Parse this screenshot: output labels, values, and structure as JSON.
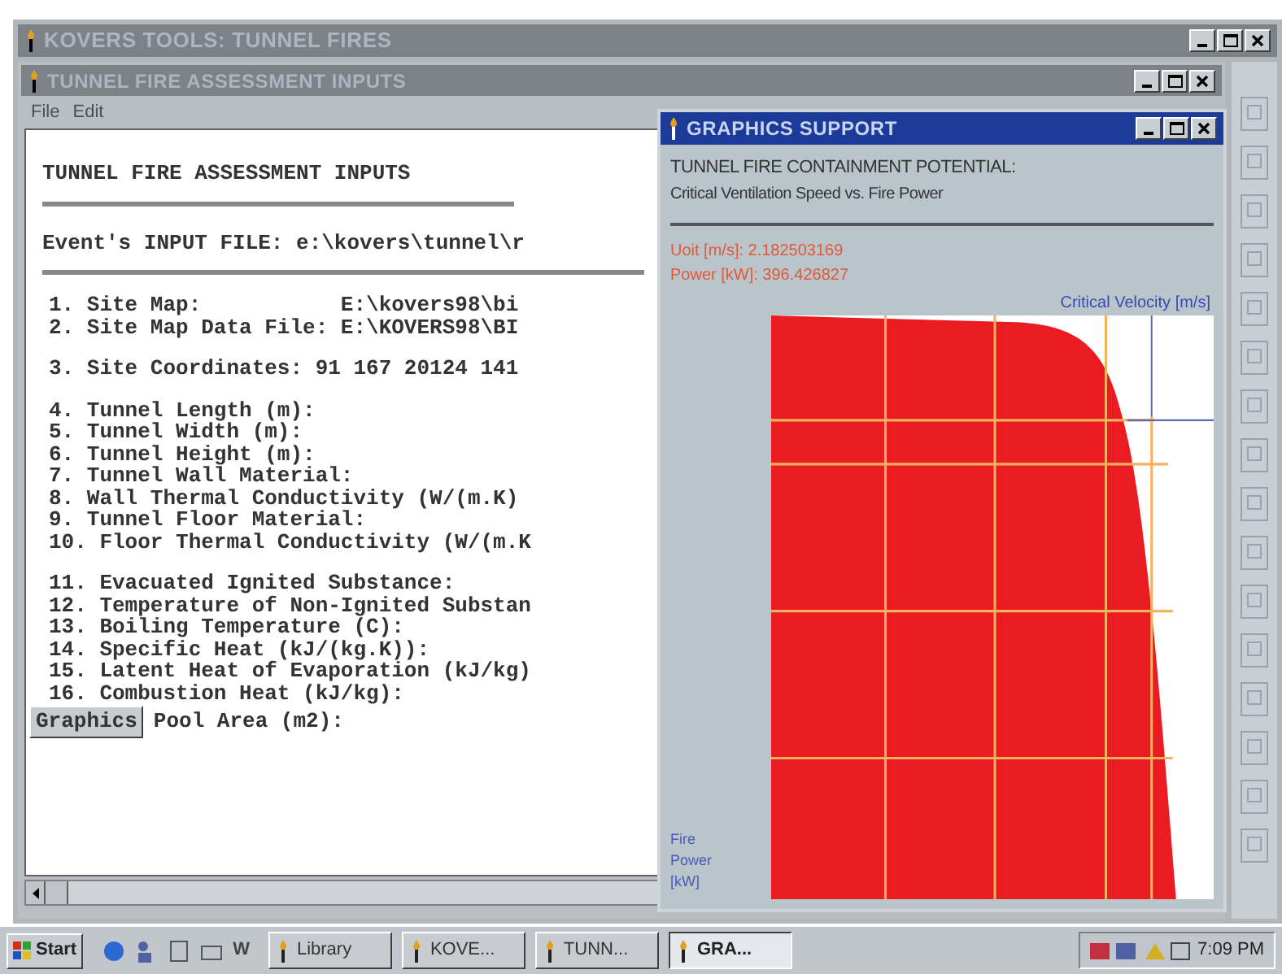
{
  "main_window": {
    "title": "KOVERS TOOLS: TUNNEL FIRES"
  },
  "inputs_window": {
    "title": "TUNNEL FIRE ASSESSMENT INPUTS",
    "menu": [
      "File",
      "Edit"
    ],
    "heading": "TUNNEL FIRE ASSESSMENT INPUTS",
    "input_file": "Event's INPUT FILE: e:\\kovers\\tunnel\\r",
    "groups": [
      [
        "1. Site Map:           E:\\kovers98\\bi",
        "2. Site Map Data File: E:\\KOVERS98\\BI"
      ],
      [
        "3. Site Coordinates: 91 167 20124 141"
      ],
      [
        "4. Tunnel Length (m):",
        "5. Tunnel Width (m):",
        "6. Tunnel Height (m):",
        "7. Tunnel Wall Material:",
        "8. Wall Thermal Conductivity (W/(m.K)",
        "9. Tunnel Floor Material:",
        "10. Floor Thermal Conductivity (W/(m.K"
      ],
      [
        "11. Evacuated Ignited Substance:",
        "12. Temperature of Non-Ignited Substan",
        "13. Boiling Temperature (C):",
        "14. Specific Heat (kJ/(kg.K)):",
        "15. Latent Heat of Evaporation (kJ/kg)",
        "16. Combustion Heat (kJ/kg):"
      ]
    ],
    "graphics_button": "Graphics",
    "last_line": "Pool Area (m2):"
  },
  "graphics_window": {
    "title": "GRAPHICS SUPPORT",
    "heading": "TUNNEL FIRE CONTAINMENT POTENTIAL:",
    "subheading": "Critical Ventilation Speed vs. Fire Power",
    "readouts": [
      "Uoit [m/s]: 2.182503169",
      "Power [kW]: 396.426827"
    ],
    "x_label": "Critical Velocity [m/s]",
    "y_label": [
      "Fire",
      "Power",
      "[kW]"
    ]
  },
  "taskbar": {
    "start": "Start",
    "quick_launch_text": "W",
    "buttons": [
      {
        "label": "Library",
        "selected": false
      },
      {
        "label": "KOVE...",
        "selected": false
      },
      {
        "label": "TUNN...",
        "selected": false
      },
      {
        "label": "GRA...",
        "selected": true
      }
    ],
    "clock": "7:09 PM"
  }
}
